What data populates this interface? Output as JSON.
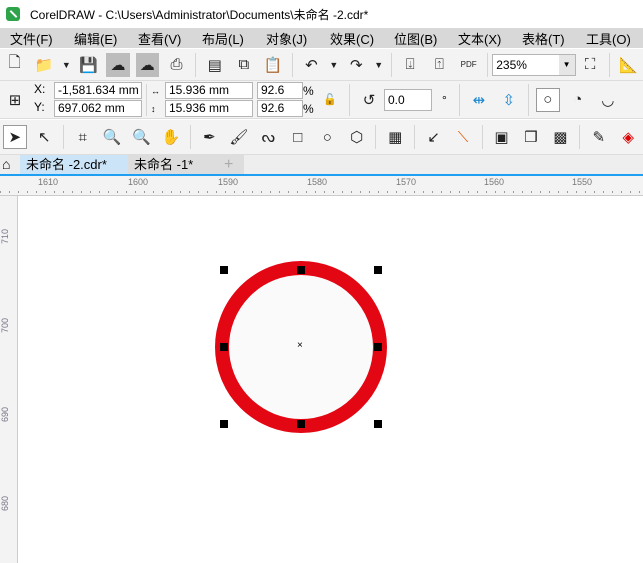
{
  "window": {
    "title": "CorelDRAW - C:\\Users\\Administrator\\Documents\\未命名 -2.cdr*"
  },
  "menu": [
    "文件(F)",
    "编辑(E)",
    "查看(V)",
    "布局(L)",
    "对象(J)",
    "效果(C)",
    "位图(B)",
    "文本(X)",
    "表格(T)",
    "工具(O)"
  ],
  "toolbar": {
    "zoom": "235%",
    "pdf_label": "PDF"
  },
  "property_bar": {
    "x_label": "X:",
    "x": "-1,581.634 mm",
    "y_label": "Y:",
    "y": "697.062 mm",
    "width": "15.936 mm",
    "height": "15.936 mm",
    "scale_x": "92.6",
    "scale_y": "92.6",
    "percent": "%",
    "rotation": "0.0",
    "degree": "°"
  },
  "tabs": [
    {
      "label": "未命名 -2.cdr*",
      "active": true
    },
    {
      "label": "未命名 -1*",
      "active": false
    }
  ],
  "ruler": {
    "h": [
      "1610",
      "1600",
      "1590",
      "1580",
      "1570",
      "1560",
      "1550"
    ],
    "v": [
      "710",
      "700",
      "690",
      "680"
    ]
  },
  "shape": {
    "type": "ellipse",
    "outline_color": "#e30613",
    "fill": "#fafafa"
  }
}
